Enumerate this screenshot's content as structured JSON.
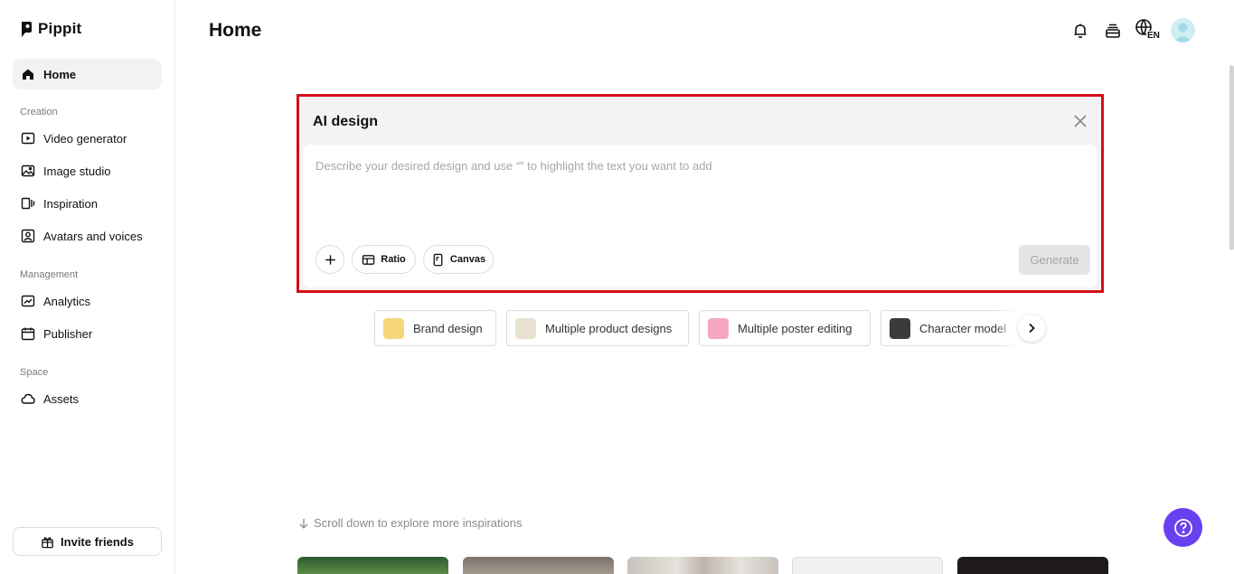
{
  "brand": {
    "name": "Pippit"
  },
  "sidebar": {
    "home": "Home",
    "sections": {
      "creation": "Creation",
      "management": "Management",
      "space": "Space"
    },
    "creation_items": [
      "Video generator",
      "Image studio",
      "Inspiration",
      "Avatars and voices"
    ],
    "management_items": [
      "Analytics",
      "Publisher"
    ],
    "space_items": [
      "Assets"
    ],
    "invite_label": "Invite friends"
  },
  "header": {
    "title": "Home",
    "lang_code": "EN",
    "icons": [
      "bell-icon",
      "layers-icon",
      "globe-icon",
      "avatar"
    ]
  },
  "ai_design": {
    "title": "AI design",
    "placeholder": "Describe your desired design and use “” to highlight the text you want to add",
    "ratio_label": "Ratio",
    "canvas_label": "Canvas",
    "generate_label": "Generate"
  },
  "chips": [
    {
      "label": "Brand design",
      "color": "#f6d77a"
    },
    {
      "label": "Multiple product designs",
      "color": "#e8e1d2"
    },
    {
      "label": "Multiple poster editing",
      "color": "#f5a8c0"
    },
    {
      "label": "Character model",
      "color": "#3b3b3b"
    }
  ],
  "scroll_hint": "Scroll down to explore more inspirations",
  "thumbnail_colors": [
    "#3d6b3a",
    "#8f8277",
    "#c9c2bc",
    "#ececec",
    "#1e1a1a"
  ],
  "accent": {
    "highlight": "#d50d16",
    "help": "#6a3ff0"
  }
}
